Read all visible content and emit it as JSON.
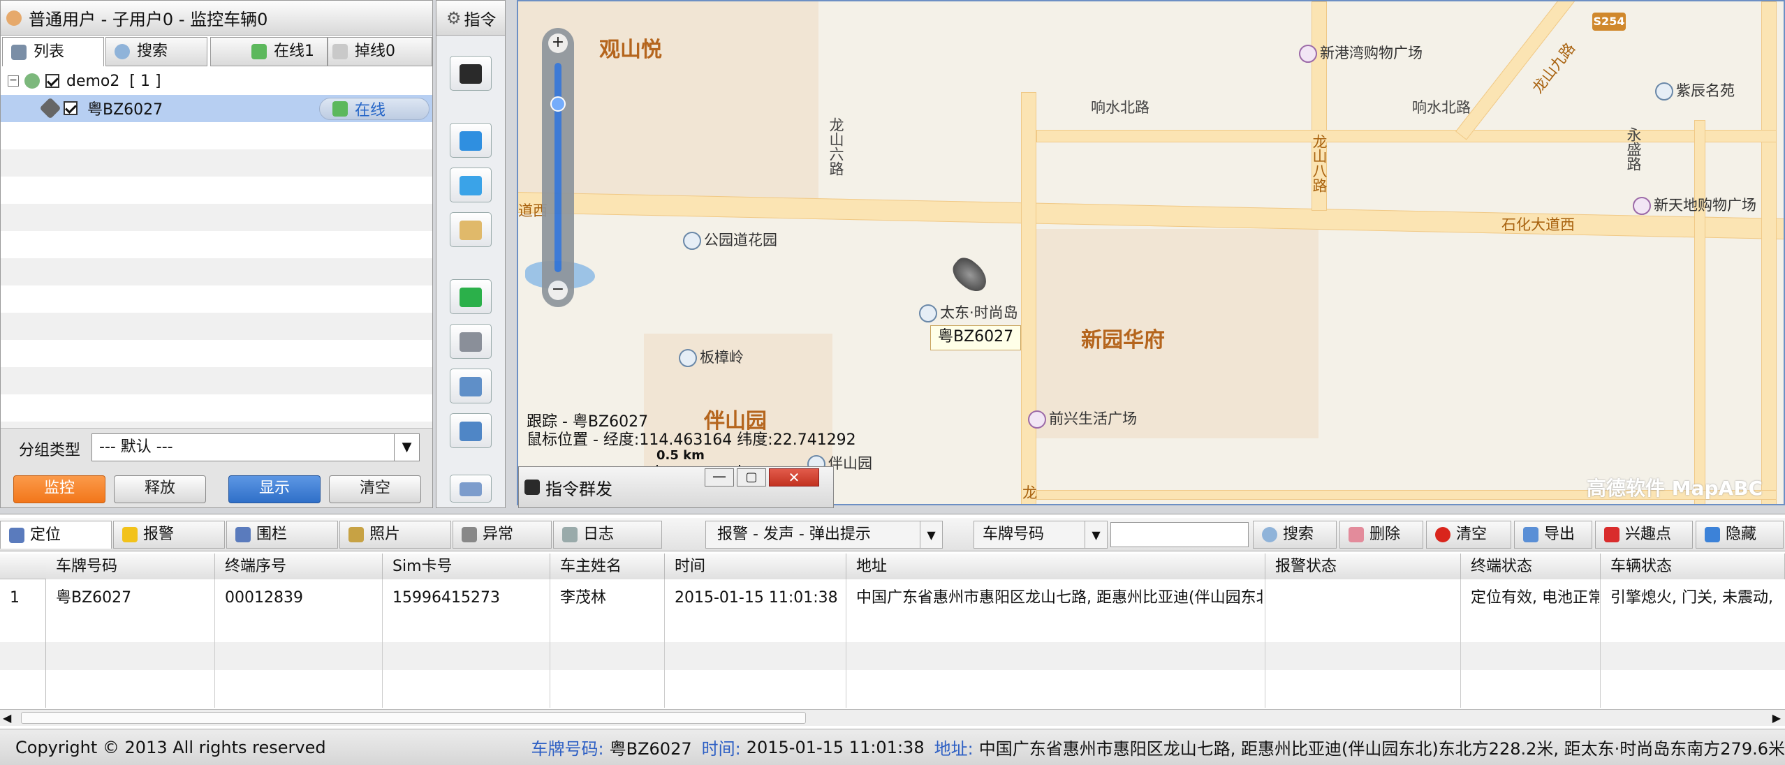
{
  "left_panel": {
    "title": "普通用户 - 子用户0 - 监控车辆0",
    "tab_list": "列表",
    "tab_search": "搜索",
    "online_label": "在线1",
    "offline_label": "掉线0",
    "tree_group": "demo2",
    "tree_count": "[ 1 ]",
    "tree_vehicle": "粤BZ6027",
    "tree_status": "在线",
    "group_type_label": "分组类型",
    "group_type_value": "--- 默认 ---",
    "btn_monitor": "监控",
    "btn_release": "释放",
    "btn_show": "显示",
    "btn_clear": "清空"
  },
  "command_panel": {
    "title": "指令"
  },
  "map": {
    "tracking": "跟踪 - 粤BZ6027",
    "mouse_pos": "鼠标位置 - 经度:114.463164 纬度:22.741292",
    "scale": "0.5 km",
    "car_label": "粤BZ6027",
    "watermark": "高德软件 MapABC",
    "districts": [
      "观山悦",
      "新园华府",
      "伴山园"
    ],
    "roads": [
      "响水北路",
      "响水北路",
      "龙山六路",
      "龙山八路",
      "龙山九路",
      "永盛路",
      "石化大道西",
      "道西",
      "龙"
    ],
    "pois": [
      "新港湾购物广场",
      "紫辰名苑",
      "新天地购物广场",
      "公园道花园",
      "太东·时尚岛",
      "板樟岭",
      "前兴生活广场",
      "伴山园"
    ],
    "shield": "S254",
    "popup_title": "指令群发"
  },
  "bottom": {
    "tabs": [
      "定位",
      "报警",
      "围栏",
      "照片",
      "异常",
      "日志"
    ],
    "alarm_select": "报警 - 发声 - 弹出提示",
    "plate_select": "车牌号码",
    "search_input": "",
    "btn_search": "搜索",
    "btn_delete": "删除",
    "btn_clear": "清空",
    "btn_export": "导出",
    "btn_poi": "兴趣点",
    "btn_hide": "隐藏",
    "columns": [
      "车牌号码",
      "终端序号",
      "Sim卡号",
      "车主姓名",
      "时间",
      "地址",
      "报警状态",
      "终端状态",
      "车辆状态"
    ],
    "rows": [
      [
        "1",
        "粤BZ6027",
        "00012839",
        "15996415273",
        "李茂林",
        "2015-01-15 11:01:38",
        "中国广东省惠州市惠阳区龙山七路, 距惠州比亚迪(伴山园东北)",
        "",
        "定位有效, 电池正常",
        "引擎熄火, 门关, 未震动,"
      ]
    ]
  },
  "status_bar": {
    "copyright": "Copyright © 2013 All rights reserved",
    "plate_key": "车牌号码:",
    "plate_val": "粤BZ6027",
    "time_key": "时间:",
    "time_val": "2015-01-15 11:01:38",
    "addr_key": "地址:",
    "addr_val": "中国广东省惠州市惠阳区龙山七路, 距惠州比亚迪(伴山园东北)东北方228.2米, 距太东·时尚岛东南方279.6米"
  }
}
